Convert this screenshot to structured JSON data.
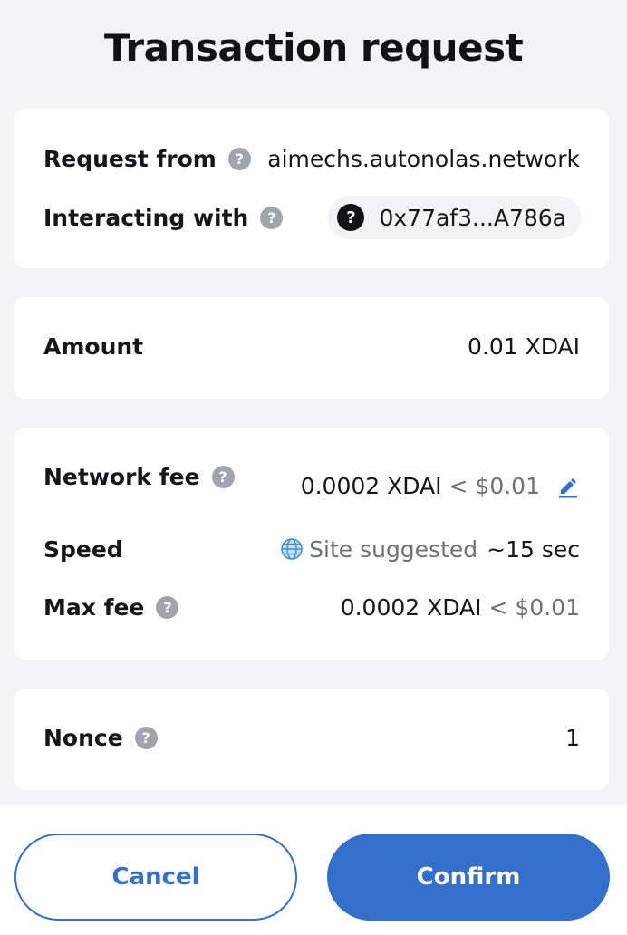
{
  "header": {
    "title": "Transaction request"
  },
  "origin": {
    "request_from_label": "Request from",
    "request_from_value": "aimechs.autonolas.network",
    "interacting_label": "Interacting with",
    "interacting_value": "0x77af3...A786a",
    "interacting_icon": "question-icon"
  },
  "amount": {
    "label": "Amount",
    "value": "0.01 XDAI"
  },
  "fees": {
    "network_fee_label": "Network fee",
    "network_fee_value": "0.0002 XDAI",
    "network_fee_fiat": "< $0.01",
    "speed_label": "Speed",
    "speed_value": "Site suggested",
    "speed_time": "~15 sec",
    "max_fee_label": "Max fee",
    "max_fee_value": "0.0002 XDAI",
    "max_fee_fiat": "< $0.01"
  },
  "nonce": {
    "label": "Nonce",
    "value": "1"
  },
  "actions": {
    "cancel_label": "Cancel",
    "confirm_label": "Confirm"
  },
  "colors": {
    "accent": "#3470c9",
    "background": "#f2f3f4",
    "card": "#ffffff",
    "muted": "#6a737d"
  }
}
